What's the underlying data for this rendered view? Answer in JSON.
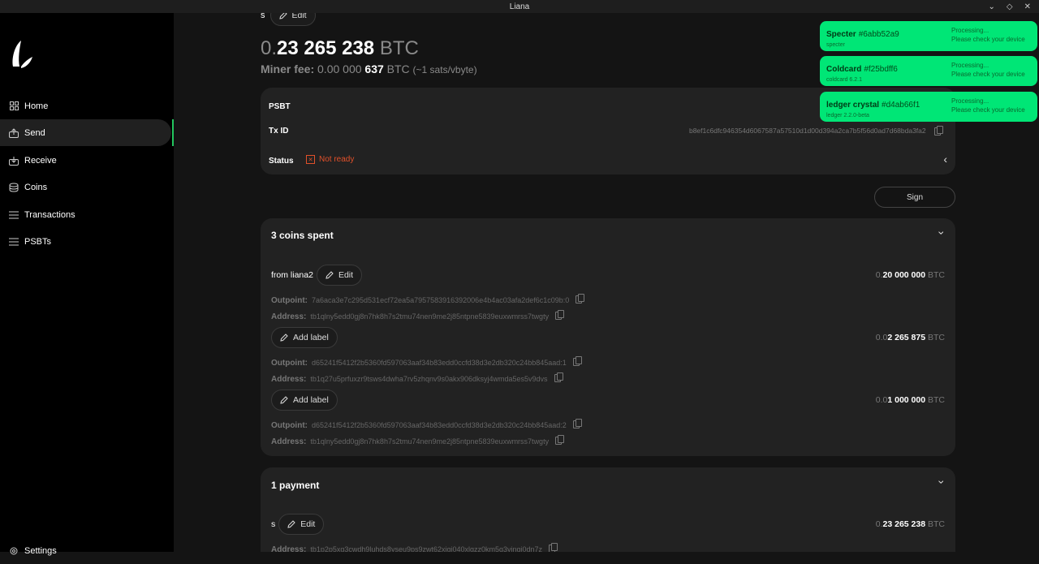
{
  "window": {
    "title": "Liana"
  },
  "sidebar": {
    "items": [
      {
        "label": "Home",
        "icon": "home-grid-icon"
      },
      {
        "label": "Send",
        "icon": "send-icon"
      },
      {
        "label": "Receive",
        "icon": "receive-icon"
      },
      {
        "label": "Coins",
        "icon": "coins-icon"
      },
      {
        "label": "Transactions",
        "icon": "list-icon"
      },
      {
        "label": "PSBTs",
        "icon": "list-icon"
      }
    ],
    "settings_label": "Settings",
    "active_color": "#22c55e"
  },
  "header": {
    "top_label": "s",
    "edit_label": "Edit",
    "amount_prefix": "0.",
    "amount_main": "23 265 238",
    "amount_unit": "BTC",
    "fee_label": "Miner fee:",
    "fee_dim": "0.00  000",
    "fee_main": "637",
    "fee_unit": "BTC",
    "fee_rate": "(~1 sats/vbyte)"
  },
  "psbt_card": {
    "psbt_label": "PSBT",
    "txid_label": "Tx ID",
    "txid_value": "b8ef1c6dfc946354d6067587a57510d1d00d394a2ca7b5f56d0ad7d68bda3fa2",
    "status_label": "Status",
    "status_value": "Not ready",
    "status_color": "#e0502a"
  },
  "sign_button": "Sign",
  "coins_card": {
    "title": "3 coins spent",
    "coins": [
      {
        "label": "from liana2",
        "button": "Edit",
        "amount_dim": "0.",
        "amount_main": "20 000 000",
        "unit": "BTC",
        "outpoint_label": "Outpoint:",
        "outpoint": "7a6aca3e7c295d531ecf72ea5a7957583916392006e4b4ac03afa2def6c1c09b:0",
        "address_label": "Address:",
        "address": "tb1qlny5edd0gj8n7hk8h7s2tmu74nen9me2j85ntpne5839euxwmrss7twgty"
      },
      {
        "label": "",
        "button": "Add label",
        "amount_dim": "0.0",
        "amount_main": "2 265 875",
        "unit": "BTC",
        "outpoint_label": "Outpoint:",
        "outpoint": "d65241f5412f2b5360fd597063aaf34b83edd0ccfd38d3e2db320c24bb845aad:1",
        "address_label": "Address:",
        "address": "tb1q27u5prfuxzr9tsws4dwha7rv5zhqnv9s0akx906dksyj4wmda5es5v9dvs"
      },
      {
        "label": "",
        "button": "Add label",
        "amount_dim": "0.0",
        "amount_main": "1 000 000",
        "unit": "BTC",
        "outpoint_label": "Outpoint:",
        "outpoint": "d65241f5412f2b5360fd597063aaf34b83edd0ccfd38d3e2db320c24bb845aad:2",
        "address_label": "Address:",
        "address": "tb1qlny5edd0gj8n7hk8h7s2tmu74nen9me2j85ntpne5839euxwmrss7twgty"
      }
    ]
  },
  "payment_card": {
    "title": "1 payment",
    "label": "s",
    "button": "Edit",
    "amount_dim": "0.",
    "amount_main": "23 265 238",
    "unit": "BTC",
    "address_label": "Address:",
    "address": "tb1p2p5xq3cwdh9luhds8yseu9ps9zwt62xjgj040xlgzz0km5q3yjnqj0dn7z"
  },
  "toasts": [
    {
      "name": "Specter",
      "fp": "#6abb52a9",
      "sub": "specter",
      "msg1": "Processing...",
      "msg2": "Please check your device"
    },
    {
      "name": "Coldcard",
      "fp": "#f25bdff6",
      "sub": "coldcard  6.2.1",
      "msg1": "Processing...",
      "msg2": "Please check your device"
    },
    {
      "name": "ledger crystal",
      "fp": "#d4ab66f1",
      "sub": "ledger  2.2.0-beta",
      "msg1": "Processing...",
      "msg2": "Please check your device"
    }
  ]
}
